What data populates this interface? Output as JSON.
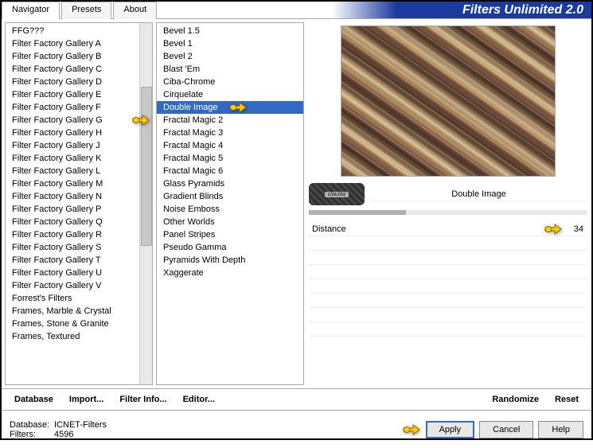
{
  "header": {
    "tabs": [
      "Navigator",
      "Presets",
      "About"
    ],
    "active_tab": 0,
    "title": "Filters Unlimited 2.0"
  },
  "categories": [
    "FFG???",
    "Filter Factory Gallery A",
    "Filter Factory Gallery B",
    "Filter Factory Gallery C",
    "Filter Factory Gallery D",
    "Filter Factory Gallery E",
    "Filter Factory Gallery F",
    "Filter Factory Gallery G",
    "Filter Factory Gallery H",
    "Filter Factory Gallery J",
    "Filter Factory Gallery K",
    "Filter Factory Gallery L",
    "Filter Factory Gallery M",
    "Filter Factory Gallery N",
    "Filter Factory Gallery P",
    "Filter Factory Gallery Q",
    "Filter Factory Gallery R",
    "Filter Factory Gallery S",
    "Filter Factory Gallery T",
    "Filter Factory Gallery U",
    "Filter Factory Gallery V",
    "Forrest's Filters",
    "Frames, Marble & Crystal",
    "Frames, Stone & Granite",
    "Frames, Textured"
  ],
  "filters": [
    "Bevel 1.5",
    "Bevel 1",
    "Bevel 2",
    "Blast 'Em",
    "Ciba-Chrome",
    "Cirquelate",
    "Double Image",
    "Fractal Magic 2",
    "Fractal Magic 3",
    "Fractal Magic 4",
    "Fractal Magic 5",
    "Fractal Magic 6",
    "Glass Pyramids",
    "Gradient Blinds",
    "Noise Emboss",
    "Other Worlds",
    "Panel Stripes",
    "Pseudo Gamma",
    "Pyramids With Depth",
    "Xaggerate"
  ],
  "selected_filter": "Double Image",
  "param_section": {
    "watermark": "claudia",
    "title": "Double Image",
    "params": [
      {
        "name": "Distance",
        "value": "34"
      }
    ]
  },
  "buttons": {
    "database": "Database",
    "import": "Import...",
    "filter_info": "Filter Info...",
    "editor": "Editor...",
    "randomize": "Randomize",
    "reset": "Reset"
  },
  "footer": {
    "db_label": "Database:",
    "db_value": "ICNET-Filters",
    "filters_label": "Filters:",
    "filters_value": "4596",
    "apply": "Apply",
    "cancel": "Cancel",
    "help": "Help"
  }
}
